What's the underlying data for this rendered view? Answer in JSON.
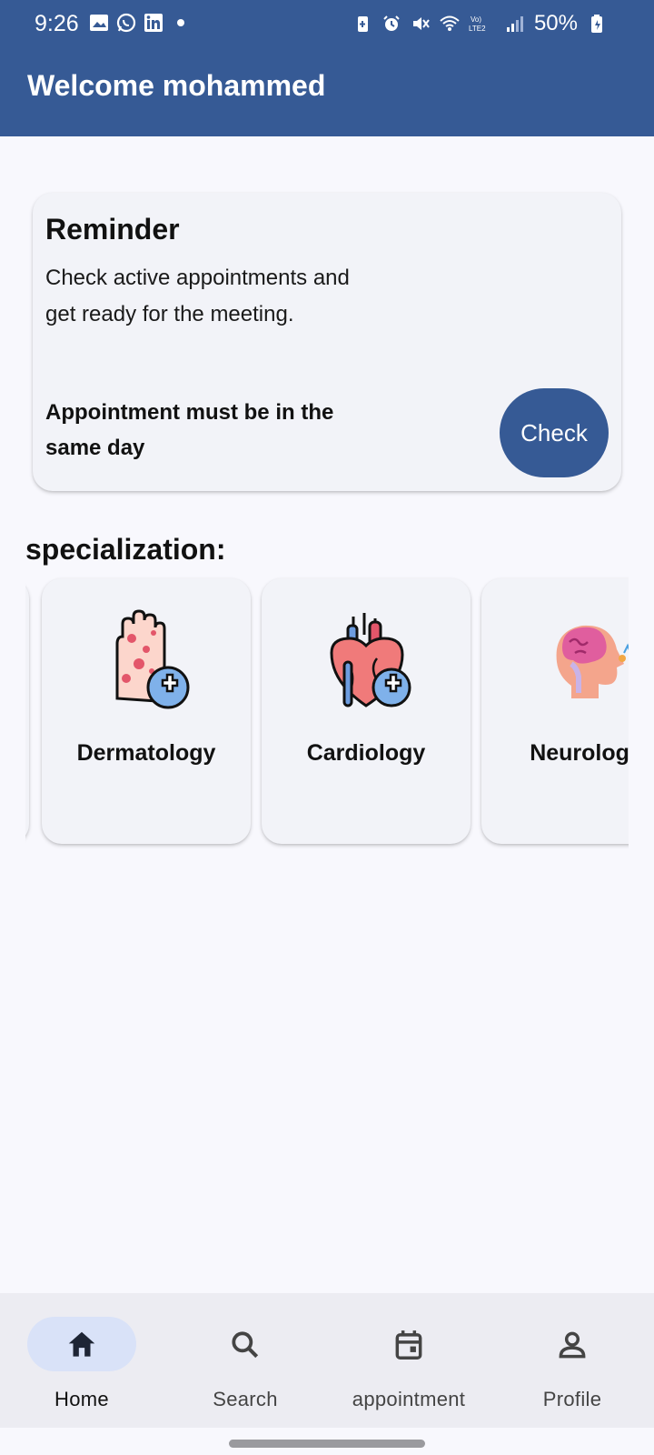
{
  "status_bar": {
    "time": "9:26",
    "battery": "50%",
    "left_icons": [
      "gallery-icon",
      "whatsapp-icon",
      "linkedin-icon",
      "dot-icon"
    ],
    "right_icons": [
      "battery-saver-icon",
      "alarm-icon",
      "mute-icon",
      "wifi-icon",
      "volte-icon",
      "signal-icon",
      "battery-icon"
    ]
  },
  "app_bar": {
    "title": "Welcome mohammed"
  },
  "reminder": {
    "title": "Reminder",
    "body": "Check active appointments and get ready for the meeting.",
    "note": "Appointment must be in the same day",
    "button_label": "Check"
  },
  "specialization": {
    "title": "specialization:",
    "items": [
      {
        "label": "Dermatology",
        "icon": "dermatology-icon"
      },
      {
        "label": "Cardiology",
        "icon": "cardiology-icon"
      },
      {
        "label": "Neurology",
        "icon": "neurology-icon"
      }
    ]
  },
  "bottom_nav": {
    "items": [
      {
        "label": "Home",
        "icon": "home-icon",
        "active": true
      },
      {
        "label": "Search",
        "icon": "search-icon",
        "active": false
      },
      {
        "label": "appointment",
        "icon": "calendar-icon",
        "active": false
      },
      {
        "label": "Profile",
        "icon": "person-icon",
        "active": false
      }
    ]
  },
  "colors": {
    "primary": "#365a95",
    "background": "#f8f8fd",
    "card": "#f2f3f8",
    "nav_active_pill": "#d9e2f8"
  }
}
